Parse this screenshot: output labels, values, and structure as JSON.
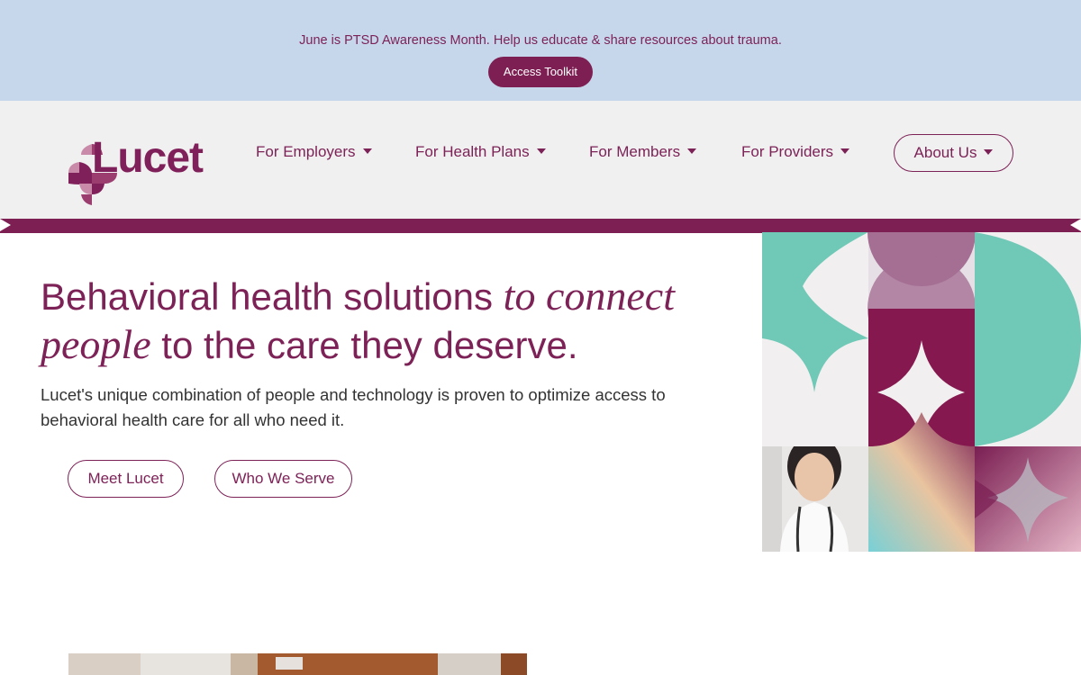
{
  "banner": {
    "text": "June is PTSD Awareness Month. Help us educate & share resources about trauma.",
    "button_label": "Access Toolkit"
  },
  "header": {
    "logo_text": "Lucet",
    "nav": [
      {
        "label": "For Employers"
      },
      {
        "label": "For Health Plans"
      },
      {
        "label": "For Members"
      },
      {
        "label": "For Providers"
      },
      {
        "label": "About Us"
      }
    ]
  },
  "hero": {
    "title_part1": "Behavioral health solutions ",
    "title_italic1": "to connect",
    "title_italic2": "people",
    "title_part2": " to the care they deserve.",
    "subtitle": "Lucet's unique combination of people and technology is proven to optimize access to behavioral health care for all who need it.",
    "buttons": [
      {
        "label": "Meet Lucet"
      },
      {
        "label": "Who We Serve"
      }
    ]
  },
  "colors": {
    "brand": "#7d2257",
    "banner_bg": "#c6d7ec",
    "header_bg": "#f0f0f0",
    "teal": "#6fc9b6"
  },
  "icons": [
    "caret-down-icon",
    "lucet-logo-icon"
  ]
}
